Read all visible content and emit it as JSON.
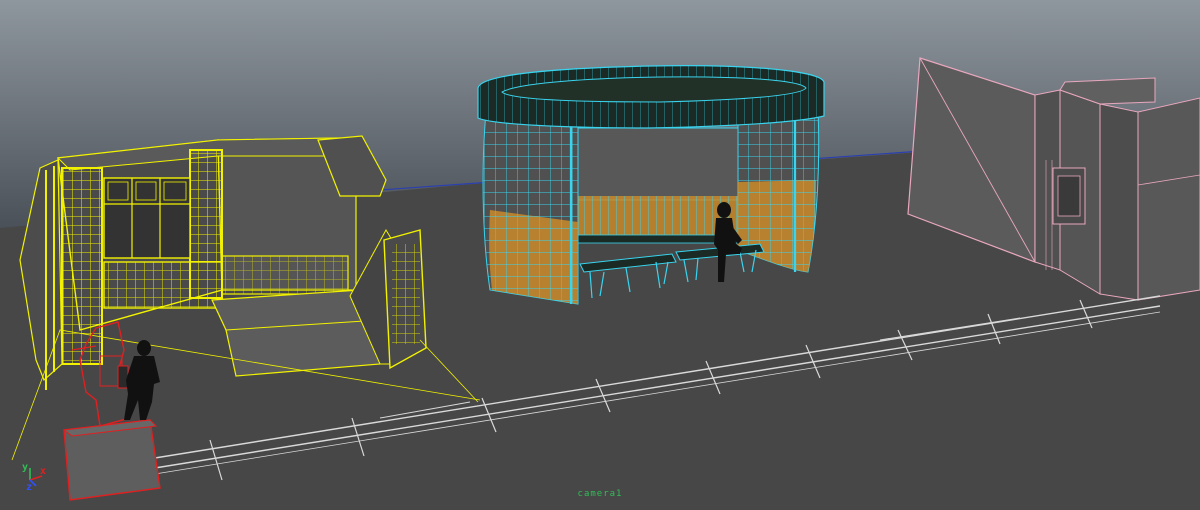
{
  "viewport": {
    "camera_label": "camera1",
    "colors": {
      "sky_top": "#8f979e",
      "sky_bottom": "#4a5058",
      "ground": "#474747",
      "horizon_line": "#2a3fb0",
      "selected_wire": "#f2f200",
      "shelter_wire": "#39d4ee",
      "building_wire": "#e8a7bd",
      "red_wire": "#e02020",
      "track_wire": "#d9d9d9",
      "silhouette": "#111111",
      "glass_orange": "#c98a2a",
      "shelter_roof": "#1c2a25",
      "camera_label": "#2fbf55"
    }
  },
  "axis_gizmo": {
    "x": "x",
    "y": "y",
    "z": "z"
  },
  "objects": [
    {
      "name": "station-kiosk",
      "state": "selected"
    },
    {
      "name": "bus-shelter",
      "state": "highlighted"
    },
    {
      "name": "building-block",
      "state": "template"
    },
    {
      "name": "rail-track",
      "state": "default"
    },
    {
      "name": "figure-standing",
      "state": "default"
    },
    {
      "name": "figure-sitting",
      "state": "default"
    }
  ]
}
